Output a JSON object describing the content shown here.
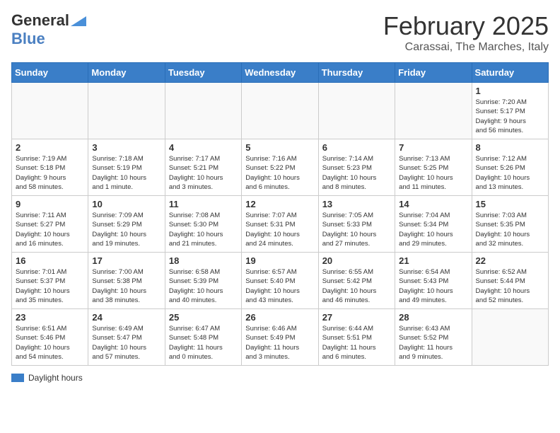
{
  "header": {
    "logo_general": "General",
    "logo_blue": "Blue",
    "month_title": "February 2025",
    "location": "Carassai, The Marches, Italy"
  },
  "weekdays": [
    "Sunday",
    "Monday",
    "Tuesday",
    "Wednesday",
    "Thursday",
    "Friday",
    "Saturday"
  ],
  "weeks": [
    [
      {
        "day": "",
        "info": ""
      },
      {
        "day": "",
        "info": ""
      },
      {
        "day": "",
        "info": ""
      },
      {
        "day": "",
        "info": ""
      },
      {
        "day": "",
        "info": ""
      },
      {
        "day": "",
        "info": ""
      },
      {
        "day": "1",
        "info": "Sunrise: 7:20 AM\nSunset: 5:17 PM\nDaylight: 9 hours\nand 56 minutes."
      }
    ],
    [
      {
        "day": "2",
        "info": "Sunrise: 7:19 AM\nSunset: 5:18 PM\nDaylight: 9 hours\nand 58 minutes."
      },
      {
        "day": "3",
        "info": "Sunrise: 7:18 AM\nSunset: 5:19 PM\nDaylight: 10 hours\nand 1 minute."
      },
      {
        "day": "4",
        "info": "Sunrise: 7:17 AM\nSunset: 5:21 PM\nDaylight: 10 hours\nand 3 minutes."
      },
      {
        "day": "5",
        "info": "Sunrise: 7:16 AM\nSunset: 5:22 PM\nDaylight: 10 hours\nand 6 minutes."
      },
      {
        "day": "6",
        "info": "Sunrise: 7:14 AM\nSunset: 5:23 PM\nDaylight: 10 hours\nand 8 minutes."
      },
      {
        "day": "7",
        "info": "Sunrise: 7:13 AM\nSunset: 5:25 PM\nDaylight: 10 hours\nand 11 minutes."
      },
      {
        "day": "8",
        "info": "Sunrise: 7:12 AM\nSunset: 5:26 PM\nDaylight: 10 hours\nand 13 minutes."
      }
    ],
    [
      {
        "day": "9",
        "info": "Sunrise: 7:11 AM\nSunset: 5:27 PM\nDaylight: 10 hours\nand 16 minutes."
      },
      {
        "day": "10",
        "info": "Sunrise: 7:09 AM\nSunset: 5:29 PM\nDaylight: 10 hours\nand 19 minutes."
      },
      {
        "day": "11",
        "info": "Sunrise: 7:08 AM\nSunset: 5:30 PM\nDaylight: 10 hours\nand 21 minutes."
      },
      {
        "day": "12",
        "info": "Sunrise: 7:07 AM\nSunset: 5:31 PM\nDaylight: 10 hours\nand 24 minutes."
      },
      {
        "day": "13",
        "info": "Sunrise: 7:05 AM\nSunset: 5:33 PM\nDaylight: 10 hours\nand 27 minutes."
      },
      {
        "day": "14",
        "info": "Sunrise: 7:04 AM\nSunset: 5:34 PM\nDaylight: 10 hours\nand 29 minutes."
      },
      {
        "day": "15",
        "info": "Sunrise: 7:03 AM\nSunset: 5:35 PM\nDaylight: 10 hours\nand 32 minutes."
      }
    ],
    [
      {
        "day": "16",
        "info": "Sunrise: 7:01 AM\nSunset: 5:37 PM\nDaylight: 10 hours\nand 35 minutes."
      },
      {
        "day": "17",
        "info": "Sunrise: 7:00 AM\nSunset: 5:38 PM\nDaylight: 10 hours\nand 38 minutes."
      },
      {
        "day": "18",
        "info": "Sunrise: 6:58 AM\nSunset: 5:39 PM\nDaylight: 10 hours\nand 40 minutes."
      },
      {
        "day": "19",
        "info": "Sunrise: 6:57 AM\nSunset: 5:40 PM\nDaylight: 10 hours\nand 43 minutes."
      },
      {
        "day": "20",
        "info": "Sunrise: 6:55 AM\nSunset: 5:42 PM\nDaylight: 10 hours\nand 46 minutes."
      },
      {
        "day": "21",
        "info": "Sunrise: 6:54 AM\nSunset: 5:43 PM\nDaylight: 10 hours\nand 49 minutes."
      },
      {
        "day": "22",
        "info": "Sunrise: 6:52 AM\nSunset: 5:44 PM\nDaylight: 10 hours\nand 52 minutes."
      }
    ],
    [
      {
        "day": "23",
        "info": "Sunrise: 6:51 AM\nSunset: 5:46 PM\nDaylight: 10 hours\nand 54 minutes."
      },
      {
        "day": "24",
        "info": "Sunrise: 6:49 AM\nSunset: 5:47 PM\nDaylight: 10 hours\nand 57 minutes."
      },
      {
        "day": "25",
        "info": "Sunrise: 6:47 AM\nSunset: 5:48 PM\nDaylight: 11 hours\nand 0 minutes."
      },
      {
        "day": "26",
        "info": "Sunrise: 6:46 AM\nSunset: 5:49 PM\nDaylight: 11 hours\nand 3 minutes."
      },
      {
        "day": "27",
        "info": "Sunrise: 6:44 AM\nSunset: 5:51 PM\nDaylight: 11 hours\nand 6 minutes."
      },
      {
        "day": "28",
        "info": "Sunrise: 6:43 AM\nSunset: 5:52 PM\nDaylight: 11 hours\nand 9 minutes."
      },
      {
        "day": "",
        "info": ""
      }
    ]
  ],
  "legend": {
    "color_label": "Daylight hours"
  }
}
